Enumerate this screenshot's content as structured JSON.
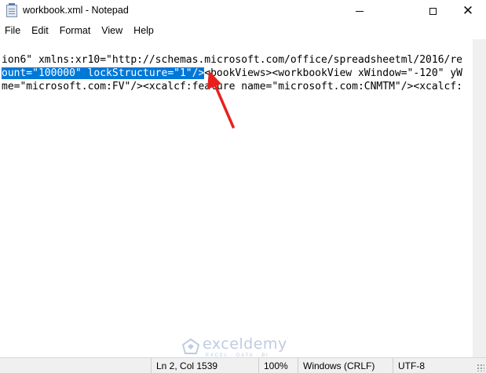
{
  "window": {
    "title": "workbook.xml - Notepad",
    "icon": "notepad-icon"
  },
  "menu": [
    "File",
    "Edit",
    "Format",
    "View",
    "Help"
  ],
  "editor": {
    "line1": "ion6\" xmlns:xr10=\"http://schemas.microsoft.com/office/spreadsheetml/2016/re",
    "line2_selected": "ount=\"100000\" lockStructure=\"1\"/>",
    "line2_rest": "<bookViews><workbookView xWindow=\"-120\" yW",
    "line3": "me=\"microsoft.com:FV\"/><xcalcf:feature name=\"microsoft.com:CNMTM\"/><xcalcf:"
  },
  "status": {
    "position": "Ln 2, Col 1539",
    "zoom": "100%",
    "line_ending": "Windows (CRLF)",
    "encoding": "UTF-8"
  },
  "watermark": {
    "name": "exceldemy",
    "tagline": "EXCEL · DATA · BI"
  },
  "colors": {
    "selection": "#0078d7",
    "arrow": "#e8201c"
  }
}
